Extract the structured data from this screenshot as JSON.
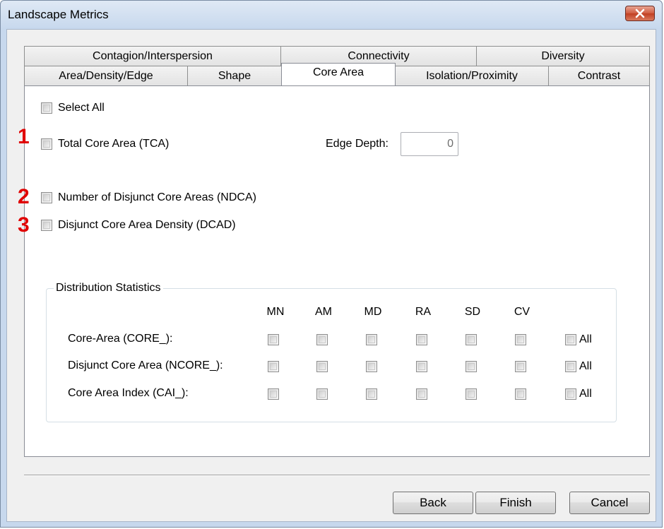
{
  "window": {
    "title": "Landscape Metrics"
  },
  "tabs": {
    "row1": [
      "Contagion/Interspersion",
      "Connectivity",
      "Diversity"
    ],
    "row2": [
      "Area/Density/Edge",
      "Shape",
      "Core Area",
      "Isolation/Proximity",
      "Contrast"
    ],
    "active": "Core Area"
  },
  "options": {
    "select_all": "Select All",
    "tca": "Total Core Area (TCA)",
    "ndca": "Number of Disjunct Core Areas (NDCA)",
    "dcad": "Disjunct Core Area Density (DCAD)"
  },
  "edge_depth": {
    "label": "Edge Depth:",
    "value": "0"
  },
  "annotations": [
    "1",
    "2",
    "3"
  ],
  "distribution": {
    "title": "Distribution Statistics",
    "columns": [
      "MN",
      "AM",
      "MD",
      "RA",
      "SD",
      "CV"
    ],
    "rows": [
      "Core-Area (CORE_):",
      "Disjunct Core Area (NCORE_):",
      "Core Area Index (CAI_):"
    ],
    "all_label": "All"
  },
  "buttons": {
    "back": "Back",
    "finish": "Finish",
    "cancel": "Cancel"
  },
  "colors": {
    "annotation": "#e00000",
    "close_button": "#c13f22",
    "titlebar": "#c7d8ed"
  }
}
